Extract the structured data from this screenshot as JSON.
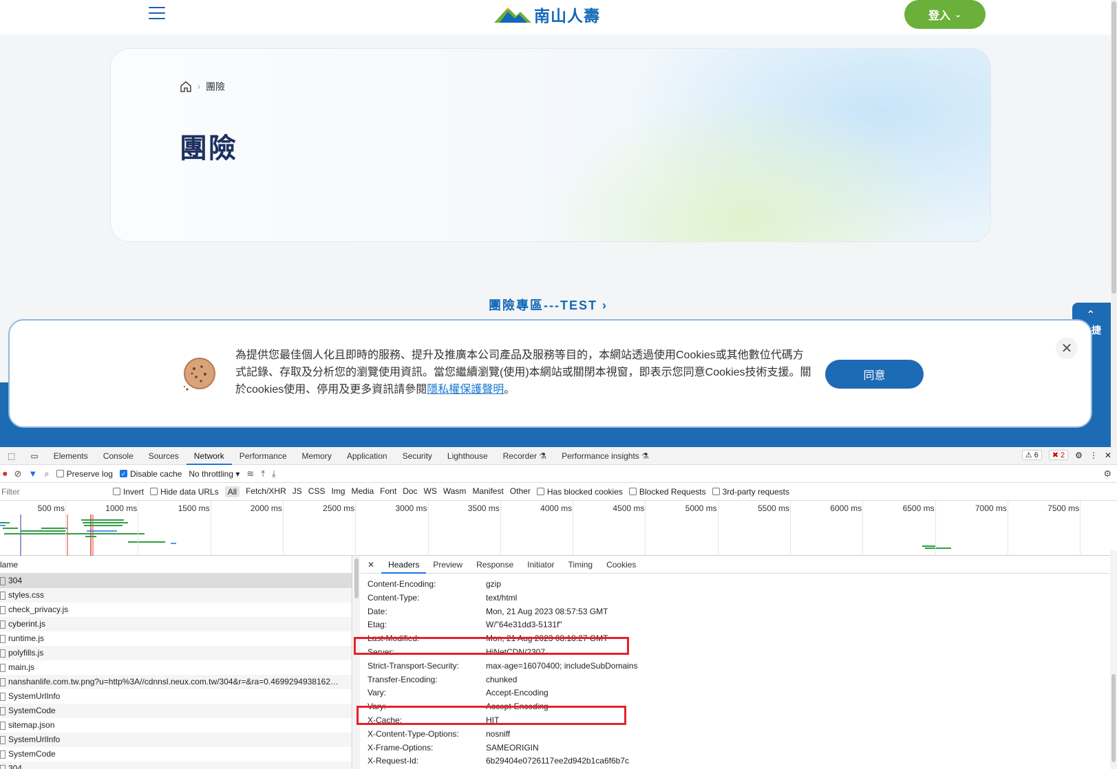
{
  "site": {
    "logo_text": "南山人壽",
    "login_label": "登入",
    "breadcrumb_current": "團險",
    "page_title": "團險",
    "section_link": "團險專區---TEST",
    "quick_tab_label": "捷"
  },
  "cookie": {
    "text_before_link": "為提供您最佳個人化且即時的服務、提升及推廣本公司產品及服務等目的，本網站透過使用Cookies或其他數位代碼方式記錄、存取及分析您的瀏覽使用資訊。當您繼續瀏覽(使用)本網站或關閉本視窗，即表示您同意Cookies技術支援。關於cookies使用、停用及更多資訊請參閱",
    "link_text": "隱私權保護聲明",
    "text_after_link": "。",
    "agree_label": "同意",
    "close_label": "✕"
  },
  "devtools": {
    "tabs": [
      "Elements",
      "Console",
      "Sources",
      "Network",
      "Performance",
      "Memory",
      "Application",
      "Security",
      "Lighthouse",
      "Recorder ⚗",
      "Performance insights ⚗"
    ],
    "warnings": "6",
    "errors": "2",
    "toolbar": {
      "preserve_log": "Preserve log",
      "disable_cache": "Disable cache",
      "throttling": "No throttling"
    },
    "filter": {
      "placeholder": "Filter",
      "invert": "Invert",
      "hide_data_urls": "Hide data URLs",
      "types": [
        "All",
        "Fetch/XHR",
        "JS",
        "CSS",
        "Img",
        "Media",
        "Font",
        "Doc",
        "WS",
        "Wasm",
        "Manifest",
        "Other"
      ],
      "has_blocked_cookies": "Has blocked cookies",
      "blocked_requests": "Blocked Requests",
      "third_party": "3rd-party requests"
    },
    "timeline_ticks": [
      "500 ms",
      "1000 ms",
      "1500 ms",
      "2000 ms",
      "2500 ms",
      "3000 ms",
      "3500 ms",
      "4000 ms",
      "4500 ms",
      "5000 ms",
      "5500 ms",
      "6000 ms",
      "6500 ms",
      "7000 ms",
      "7500 ms"
    ],
    "request_list_header": "lame",
    "requests": [
      "304",
      "styles.css",
      "check_privacy.js",
      "cyberint.js",
      "runtime.js",
      "polyfills.js",
      "main.js",
      "nanshanlife.com.tw.png?u=http%3A//cdnnsl.neux.com.tw/304&r=&ra=0.4699294938162…",
      "SystemUrlInfo",
      "SystemCode",
      "sitemap.json",
      "SystemUrlInfo",
      "SystemCode",
      "304"
    ],
    "detail_tabs": [
      "Headers",
      "Preview",
      "Response",
      "Initiator",
      "Timing",
      "Cookies"
    ],
    "headers": [
      {
        "k": "Content-Encoding:",
        "v": "gzip"
      },
      {
        "k": "Content-Type:",
        "v": "text/html"
      },
      {
        "k": "Date:",
        "v": "Mon, 21 Aug 2023 08:57:53 GMT"
      },
      {
        "k": "Etag:",
        "v": "W/\"64e31dd3-5131f\""
      },
      {
        "k": "Last-Modified:",
        "v": "Mon, 21 Aug 2023 08:18:27 GMT"
      },
      {
        "k": "Server:",
        "v": "HiNetCDN/2307"
      },
      {
        "k": "Strict-Transport-Security:",
        "v": "max-age=16070400; includeSubDomains"
      },
      {
        "k": "Transfer-Encoding:",
        "v": "chunked"
      },
      {
        "k": "Vary:",
        "v": "Accept-Encoding"
      },
      {
        "k": "Vary:",
        "v": "Accept-Encoding"
      },
      {
        "k": "X-Cache:",
        "v": "HIT"
      },
      {
        "k": "X-Content-Type-Options:",
        "v": "nosniff"
      },
      {
        "k": "X-Frame-Options:",
        "v": "SAMEORIGIN"
      },
      {
        "k": "X-Request-Id:",
        "v": "6b29404e0726117ee2d942b1ca6f6b7c"
      }
    ]
  }
}
